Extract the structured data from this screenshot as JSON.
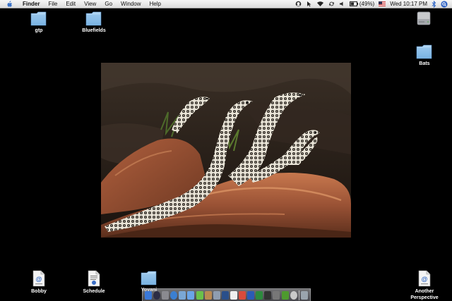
{
  "menubar": {
    "app_name": "Finder",
    "menus": [
      "File",
      "Edit",
      "View",
      "Go",
      "Window",
      "Help"
    ],
    "battery": "(49%)",
    "clock": "Wed 10:17 PM",
    "icons": [
      "apple-icon",
      "support-icon",
      "cursor-icon",
      "wifi-icon",
      "sync-icon",
      "volume-icon",
      "battery-icon",
      "flag-icon",
      "bluetooth-icon",
      "spotlight-icon"
    ]
  },
  "desktop": {
    "icons": [
      {
        "label": "gtp",
        "kind": "folder"
      },
      {
        "label": "Bluefields",
        "kind": "folder"
      },
      {
        "label": "",
        "kind": "hard-drive"
      },
      {
        "label": "Bats",
        "kind": "folder"
      },
      {
        "label": "Bobby",
        "kind": "web-location"
      },
      {
        "label": "Schedule",
        "kind": "document"
      },
      {
        "label": "Yovani",
        "kind": "folder"
      },
      {
        "label": "Another Perspective",
        "kind": "web-location"
      }
    ]
  },
  "picture": {
    "subject": "perentie-lizards-on-rocks"
  },
  "dock": {
    "items": [
      "finder-icon",
      "dashboard-icon",
      "system-preferences-icon",
      "safari-icon",
      "mail-icon",
      "itunes-icon",
      "ichat-icon",
      "addressbook-icon",
      "preview-icon",
      "photoshop-icon",
      "textedit-icon",
      "calendar-icon",
      "word-icon",
      "excel-icon",
      "terminal-icon",
      "calculator-icon",
      "activity-icon",
      "chess-icon",
      "trash-icon"
    ],
    "colors": [
      "#3a78d8",
      "#2c2c44",
      "#8a8a90",
      "#3b7fd1",
      "#7aa7d6",
      "#6aa4e8",
      "#6ac14a",
      "#b98a52",
      "#8f9db0",
      "#2a4f8a",
      "#f0f0f0",
      "#d94b3b",
      "#2b5bb5",
      "#2d8a3e",
      "#333333",
      "#777777",
      "#4e9a2e",
      "#c9c9c9",
      "#9aa4ad"
    ]
  }
}
